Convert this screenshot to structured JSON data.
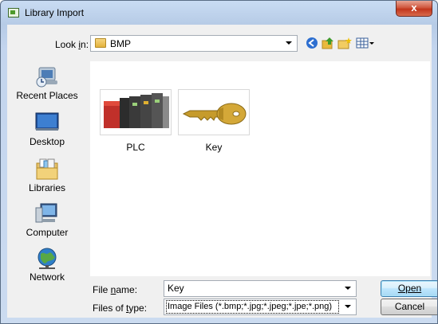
{
  "window": {
    "title": "Library Import",
    "close_label": "x"
  },
  "lookin": {
    "label": "Look in:",
    "label_underline": "i",
    "value": "BMP"
  },
  "toolbar": {
    "back_icon": "back-arrow-icon",
    "up_icon": "up-folder-icon",
    "newfolder_icon": "new-folder-icon",
    "views_icon": "view-menu-icon"
  },
  "places": [
    {
      "label": "Recent Places",
      "icon": "recent-places-icon"
    },
    {
      "label": "Desktop",
      "icon": "desktop-icon"
    },
    {
      "label": "Libraries",
      "icon": "libraries-icon"
    },
    {
      "label": "Computer",
      "icon": "computer-icon"
    },
    {
      "label": "Network",
      "icon": "network-icon"
    }
  ],
  "files": [
    {
      "name": "PLC",
      "icon": "plc-thumbnail"
    },
    {
      "name": "Key",
      "icon": "key-thumbnail"
    }
  ],
  "filename": {
    "label": "File name:",
    "value": "Key"
  },
  "filetype": {
    "label": "Files of type:",
    "value": "Image Files (*.bmp;*.jpg;*.jpeg;*.jpe;*.png)"
  },
  "buttons": {
    "open": "Open",
    "cancel": "Cancel"
  }
}
